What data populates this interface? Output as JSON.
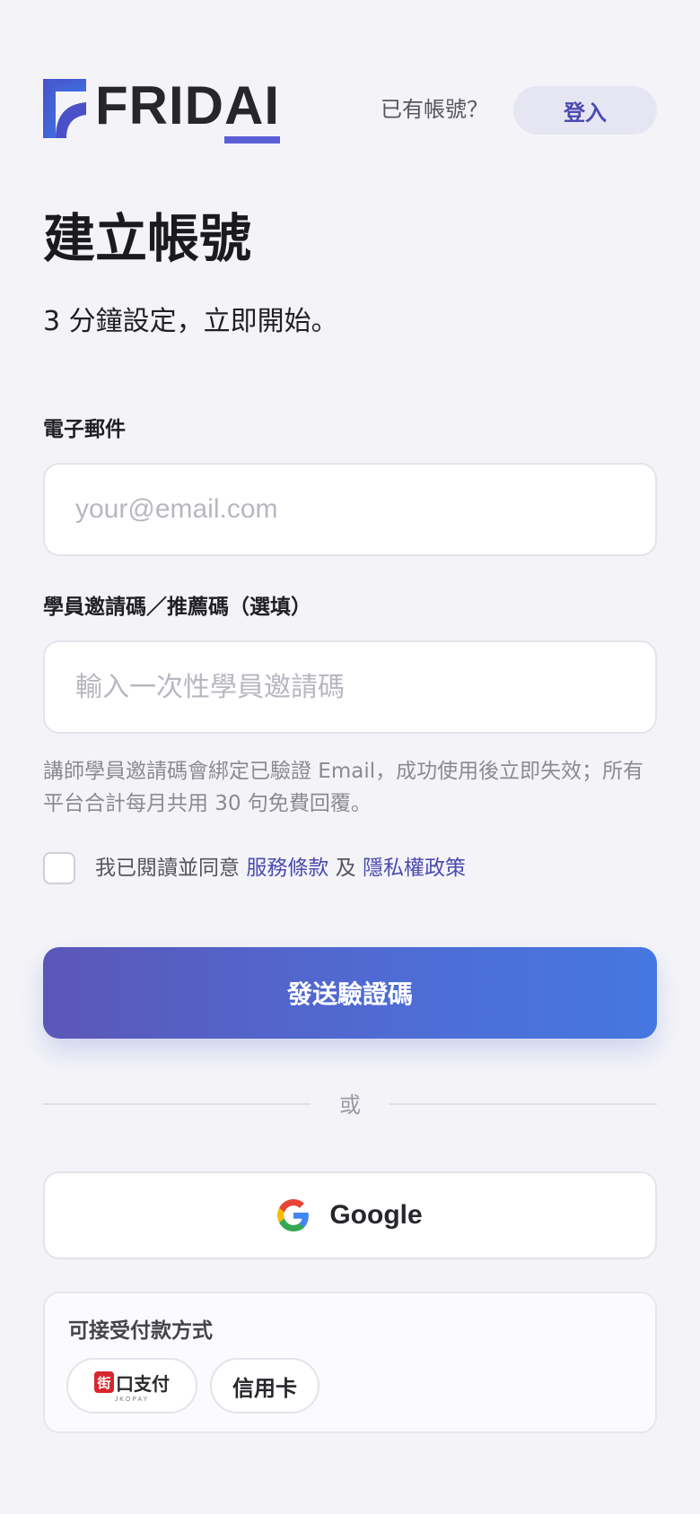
{
  "header": {
    "logo_text_main": "FRID",
    "logo_text_accent": "AI",
    "have_account": "已有帳號？",
    "login_label": "登入"
  },
  "title": "建立帳號",
  "subtitle": "3 分鐘設定，立即開始。",
  "form": {
    "email": {
      "label": "電子郵件",
      "placeholder": "your@email.com",
      "value": ""
    },
    "invite": {
      "label": "學員邀請碼／推薦碼（選填）",
      "placeholder": "輸入一次性學員邀請碼",
      "value": ""
    },
    "hint": "講師學員邀請碼會綁定已驗證 Email，成功使用後立即失效；所有平台合計每月共用 30 句免費回覆。",
    "agree": {
      "prefix": "我已閱讀並同意 ",
      "terms": "服務條款",
      "and": " 及 ",
      "privacy": "隱私權政策"
    },
    "submit_label": "發送驗證碼"
  },
  "divider_text": "或",
  "google_label": "Google",
  "payments": {
    "title": "可接受付款方式",
    "jko_name": "口支付",
    "jko_mark": "街",
    "jko_sub": "JKOPAY",
    "card_label": "信用卡"
  },
  "colors": {
    "accent": "#4b4ab0",
    "brand_blue": "#5b5fd6",
    "button_gradient_start": "#5b57b8",
    "button_gradient_end": "#4577e0",
    "background": "#f4f4f8"
  },
  "icons": [
    "fridai-logo-mark",
    "google-icon",
    "jkopay-icon",
    "checkbox"
  ]
}
